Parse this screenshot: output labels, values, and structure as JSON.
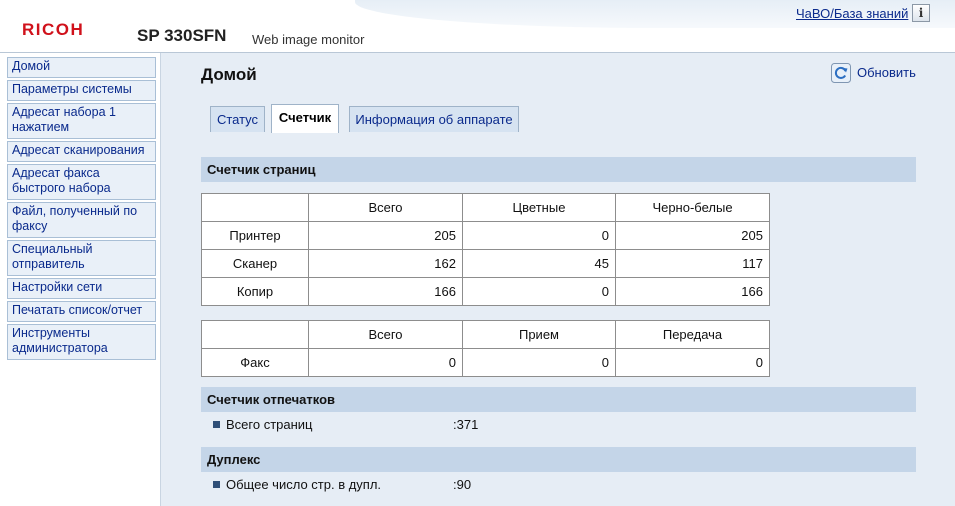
{
  "header": {
    "logo": "RICOH",
    "model": "SP 330SFN",
    "subtitle": "Web image monitor",
    "faq_link": "ЧаВО/База знаний",
    "info_icon": "i"
  },
  "sidebar": {
    "items": [
      {
        "label": "Домой"
      },
      {
        "label": "Параметры системы"
      },
      {
        "label": "Адресат набора 1 нажатием"
      },
      {
        "label": "Адресат сканирования"
      },
      {
        "label": "Адресат факса быстрого набора"
      },
      {
        "label": "Файл, полученный по факсу"
      },
      {
        "label": "Специальный отправитель"
      },
      {
        "label": "Настройки сети"
      },
      {
        "label": "Печатать список/отчет"
      },
      {
        "label": "Инструменты администратора"
      }
    ]
  },
  "main": {
    "title": "Домой",
    "refresh_label": "Обновить",
    "tabs": [
      {
        "label": "Статус"
      },
      {
        "label": "Счетчик",
        "active": true
      },
      {
        "label": "Информация об аппарате"
      }
    ],
    "page_counter": {
      "title": "Счетчик страниц",
      "columns": [
        "Всего",
        "Цветные",
        "Черно-белые"
      ],
      "rows": [
        {
          "name": "Принтер",
          "values": [
            "205",
            "0",
            "205"
          ]
        },
        {
          "name": "Сканер",
          "values": [
            "162",
            "45",
            "117"
          ]
        },
        {
          "name": "Копир",
          "values": [
            "166",
            "0",
            "166"
          ]
        }
      ]
    },
    "fax_counter": {
      "columns": [
        "Всего",
        "Прием",
        "Передача"
      ],
      "rows": [
        {
          "name": "Факс",
          "values": [
            "0",
            "0",
            "0"
          ]
        }
      ]
    },
    "print_counter": {
      "title": "Счетчик отпечатков",
      "label": "Всего страниц",
      "value": ":371"
    },
    "duplex": {
      "title": "Дуплекс",
      "label": "Общее число стр. в дупл.",
      "value": ":90"
    }
  },
  "colors": {
    "brand": "#d0111b",
    "link": "#0a2a8c",
    "section_bar": "#c4d5e8",
    "content_bg": "#e6edf5"
  },
  "icons": [
    "info-icon",
    "refresh-icon",
    "bullet-icon"
  ]
}
